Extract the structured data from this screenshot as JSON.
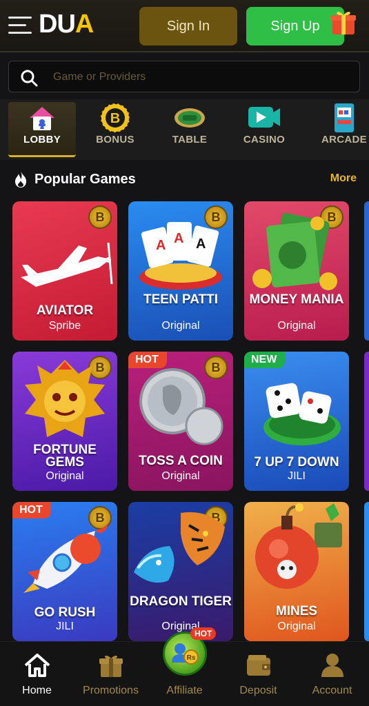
{
  "header": {
    "logo_main": "DU",
    "logo_accent": "A",
    "signin_label": "Sign In",
    "signup_label": "Sign Up"
  },
  "search": {
    "placeholder": "Game or Providers"
  },
  "categories": [
    {
      "label": "LOBBY",
      "icon": "lobby-house-icon",
      "active": true
    },
    {
      "label": "BONUS",
      "icon": "bonus-coin-icon",
      "active": false
    },
    {
      "label": "TABLE",
      "icon": "table-icon",
      "active": false
    },
    {
      "label": "CASINO",
      "icon": "casino-icon",
      "active": false
    },
    {
      "label": "ARCADE",
      "icon": "arcade-icon",
      "active": false
    }
  ],
  "section": {
    "title": "Popular Games",
    "more_label": "More"
  },
  "games": [
    {
      "name": "AVIATOR",
      "provider": "Spribe",
      "tag": "",
      "bg": "#d7253e"
    },
    {
      "name": "TEEN PATTI",
      "provider": "Original",
      "tag": "",
      "bg": "#1f6fd6"
    },
    {
      "name": "MONEY MANIA",
      "provider": "Original",
      "tag": "",
      "bg": "#cf2d5e"
    },
    {
      "name": "FORTUNE GEMS",
      "provider": "Original",
      "tag": "",
      "bg": "#6a2ad0"
    },
    {
      "name": "TOSS A COIN",
      "provider": "Original",
      "tag": "HOT",
      "bg": "#c4207a"
    },
    {
      "name": "7 UP 7 DOWN",
      "provider": "JILI",
      "tag": "NEW",
      "bg": "#2a6ed8"
    },
    {
      "name": "GO RUSH",
      "provider": "JILI",
      "tag": "HOT",
      "bg": "#1d7fe0"
    },
    {
      "name": "DRAGON TIGER",
      "provider": "Original",
      "tag": "",
      "bg": "#1b3fa8"
    },
    {
      "name": "MINES",
      "provider": "Original",
      "tag": "",
      "bg": "#e4702a"
    }
  ],
  "nav": [
    {
      "label": "Home",
      "icon": "home-icon"
    },
    {
      "label": "Promotions",
      "icon": "gift-icon"
    },
    {
      "label": "Affiliate",
      "icon": "affiliate-icon",
      "badge": "HOT"
    },
    {
      "label": "Deposit",
      "icon": "wallet-icon"
    },
    {
      "label": "Account",
      "icon": "account-icon"
    }
  ],
  "colors": {
    "accent": "#e8b722",
    "signup": "#2fbf46",
    "signin": "#6a5410",
    "background": "#141416"
  }
}
